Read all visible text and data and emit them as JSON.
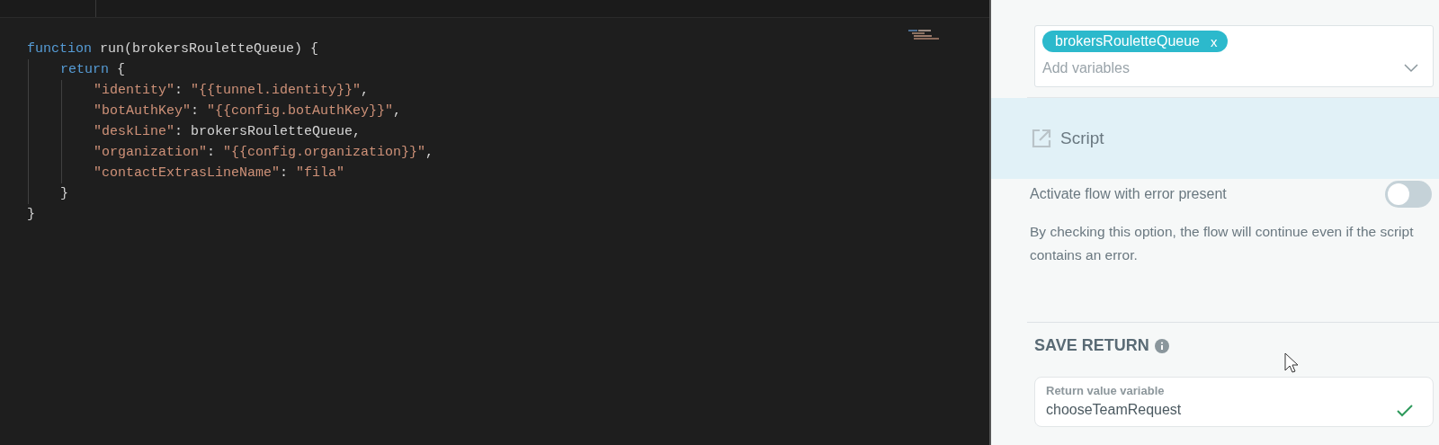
{
  "editor": {
    "lines": [
      {
        "tokens": [
          {
            "kind": "keyword",
            "text": "function"
          },
          {
            "kind": "plain",
            "text": " run(brokersRouletteQueue) {"
          }
        ],
        "children": [
          {
            "tokens": [
              {
                "kind": "keyword",
                "text": "return"
              },
              {
                "kind": "plain",
                "text": " {"
              }
            ],
            "children": [
              {
                "tokens": [
                  {
                    "kind": "string",
                    "text": "\"identity\""
                  },
                  {
                    "kind": "plain",
                    "text": ": "
                  },
                  {
                    "kind": "string",
                    "text": "\"{{tunnel.identity}}\""
                  },
                  {
                    "kind": "plain",
                    "text": ","
                  }
                ]
              },
              {
                "tokens": [
                  {
                    "kind": "string",
                    "text": "\"botAuthKey\""
                  },
                  {
                    "kind": "plain",
                    "text": ": "
                  },
                  {
                    "kind": "string",
                    "text": "\"{{config.botAuthKey}}\""
                  },
                  {
                    "kind": "plain",
                    "text": ","
                  }
                ]
              },
              {
                "tokens": [
                  {
                    "kind": "string",
                    "text": "\"deskLine\""
                  },
                  {
                    "kind": "plain",
                    "text": ": brokersRouletteQueue,"
                  }
                ]
              },
              {
                "tokens": [
                  {
                    "kind": "string",
                    "text": "\"organization\""
                  },
                  {
                    "kind": "plain",
                    "text": ": "
                  },
                  {
                    "kind": "string",
                    "text": "\"{{config.organization}}\""
                  },
                  {
                    "kind": "plain",
                    "text": ","
                  }
                ]
              },
              {
                "tokens": [
                  {
                    "kind": "string",
                    "text": "\"contactExtrasLineName\""
                  },
                  {
                    "kind": "plain",
                    "text": ": "
                  },
                  {
                    "kind": "string",
                    "text": "\"fila\""
                  }
                ]
              }
            ]
          },
          {
            "tokens": [
              {
                "kind": "plain",
                "text": "}"
              }
            ]
          }
        ]
      },
      {
        "tokens": [
          {
            "kind": "plain",
            "text": "}"
          }
        ]
      }
    ]
  },
  "panel": {
    "variables_field": {
      "chips": [
        {
          "label": "brokersRouletteQueue",
          "remove": "x"
        }
      ],
      "placeholder": "Add variables"
    },
    "script_item": {
      "label": "Script",
      "highlighted": true
    },
    "activate_toggle": {
      "label": "Activate flow with error present",
      "on": false
    },
    "description": "By checking this option, the flow will continue even if the script contains an error.",
    "save_return": {
      "title": "SAVE RETURN",
      "field": {
        "label": "Return value variable",
        "value": "chooseTeamRequest",
        "valid": true
      }
    }
  }
}
